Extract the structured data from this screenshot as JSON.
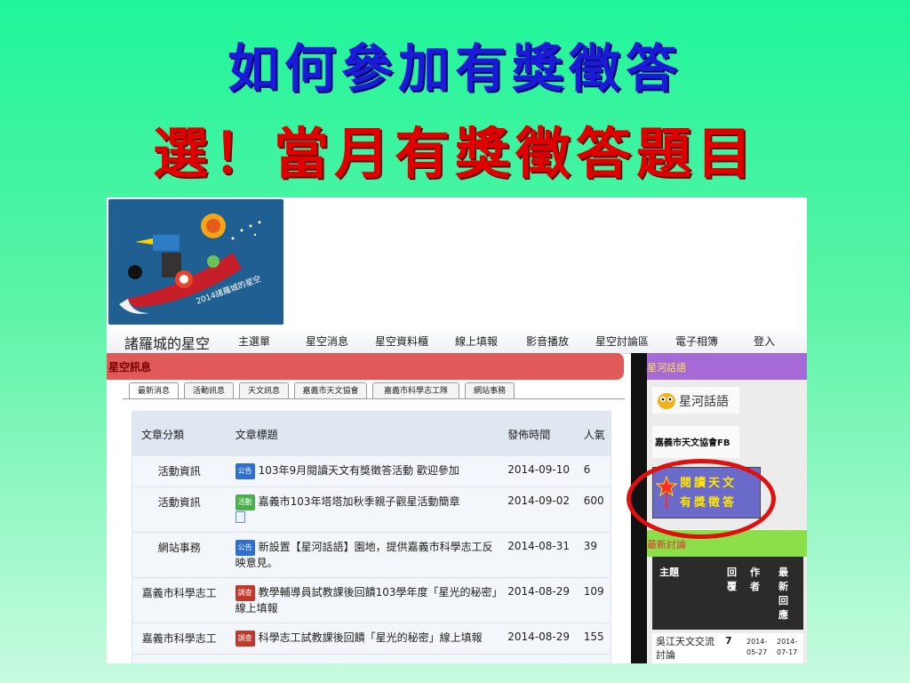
{
  "slide": {
    "title_line1": "如何參加有獎徵答",
    "title_line2": "選！當月有獎徵答題目"
  },
  "logo": {
    "caption": "2014諸羅城的星空"
  },
  "nav": {
    "site_name": "諸羅城的星空",
    "items": [
      "主選單",
      "星空消息",
      "星空資料櫃",
      "線上填報",
      "影音播放",
      "星空討論區",
      "電子相簿",
      "登入"
    ]
  },
  "news": {
    "header": "星空訊息",
    "tabs": [
      "最新消息",
      "活動訊息",
      "天文訊息",
      "嘉義市天文協會",
      "嘉義市科學志工隊",
      "網站事務"
    ],
    "columns": [
      "文章分類",
      "文章標題",
      "發佈時間",
      "人氣"
    ],
    "rows": [
      {
        "category": "活動資訊",
        "badge": "公告",
        "title": "103年9月閱讀天文有獎徵答活動 歡迎參加",
        "date": "2014-09-10",
        "views": "6"
      },
      {
        "category": "活動資訊",
        "badge": "活動",
        "title": "嘉義市103年塔塔加秋季親子觀星活動簡章",
        "date": "2014-09-02",
        "views": "600"
      },
      {
        "category": "網站事務",
        "badge": "公告",
        "title": "新設置【星河話語】園地，提供嘉義市科學志工反映意見。",
        "date": "2014-08-31",
        "views": "39"
      },
      {
        "category": "嘉義市科學志工",
        "badge": "調查",
        "title": "教學輔導員試教課後回饋103學年度「星光的秘密」線上填報",
        "date": "2014-08-29",
        "views": "109"
      },
      {
        "category": "嘉義市科學志工",
        "badge": "調查",
        "title": "科學志工試教課後回饋「星光的秘密」線上填報",
        "date": "2014-08-29",
        "views": "155"
      }
    ]
  },
  "sidebar": {
    "header": "星河話語",
    "galaxy_button": "星河話語",
    "fb_button": "嘉義市天文協會FB",
    "read_button_line1": "閱讀天文",
    "read_button_line2": "有獎徵答"
  },
  "discussion": {
    "header": "最新討論",
    "columns": [
      "主題",
      "回覆",
      "作者",
      "最新回應"
    ],
    "row": {
      "topic": "吳江天文交流討論",
      "replies": "7",
      "author_date": "2014-05-27",
      "latest": "2014-07-17"
    }
  },
  "colors": {
    "title_blue": "#1a1ad8",
    "title_red": "#e00000",
    "news_header": "#e05a5a",
    "sidebar_header": "#a56ad6",
    "discussion_header": "#8be04a",
    "highlight_ring": "#e01010"
  }
}
